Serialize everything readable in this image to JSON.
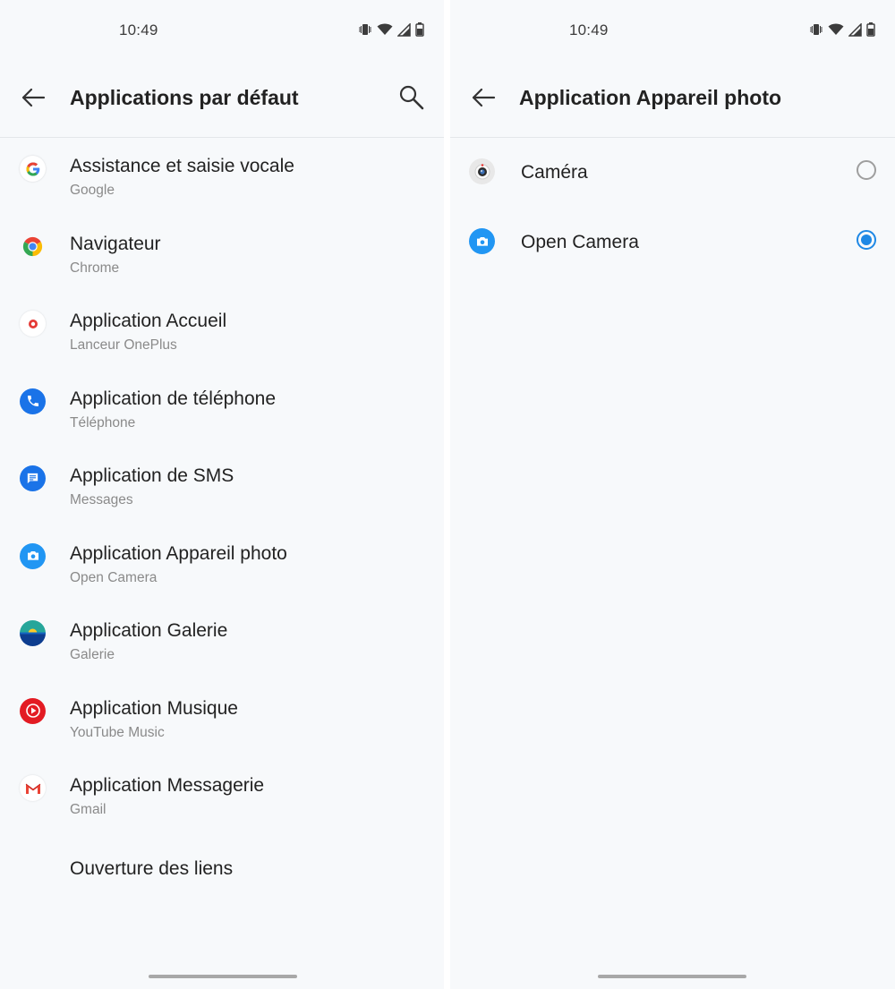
{
  "left_screen": {
    "status": {
      "time": "10:49"
    },
    "title": "Applications par défaut",
    "items": [
      {
        "title": "Assistance et saisie vocale",
        "subtitle": "Google",
        "icon": "google-icon"
      },
      {
        "title": "Navigateur",
        "subtitle": "Chrome",
        "icon": "chrome-icon"
      },
      {
        "title": "Application Accueil",
        "subtitle": "Lanceur OnePlus",
        "icon": "oneplus-launcher-icon"
      },
      {
        "title": "Application de téléphone",
        "subtitle": "Téléphone",
        "icon": "phone-icon"
      },
      {
        "title": "Application de SMS",
        "subtitle": "Messages",
        "icon": "messages-icon"
      },
      {
        "title": "Application Appareil photo",
        "subtitle": "Open Camera",
        "icon": "camera-icon"
      },
      {
        "title": "Application Galerie",
        "subtitle": "Galerie",
        "icon": "gallery-icon"
      },
      {
        "title": "Application Musique",
        "subtitle": "YouTube Music",
        "icon": "youtube-music-icon"
      },
      {
        "title": "Application Messagerie",
        "subtitle": "Gmail",
        "icon": "gmail-icon"
      },
      {
        "title": "Ouverture des liens"
      }
    ]
  },
  "right_screen": {
    "status": {
      "time": "10:49"
    },
    "title": "Application Appareil photo",
    "options": [
      {
        "label": "Caméra",
        "selected": false,
        "icon": "oneplus-camera-icon"
      },
      {
        "label": "Open Camera",
        "selected": true,
        "icon": "open-camera-icon"
      }
    ]
  },
  "colors": {
    "background": "#f7f9fb",
    "accent": "#1e88e5",
    "primary_text": "#222222",
    "secondary_text": "#8a8a8a"
  }
}
